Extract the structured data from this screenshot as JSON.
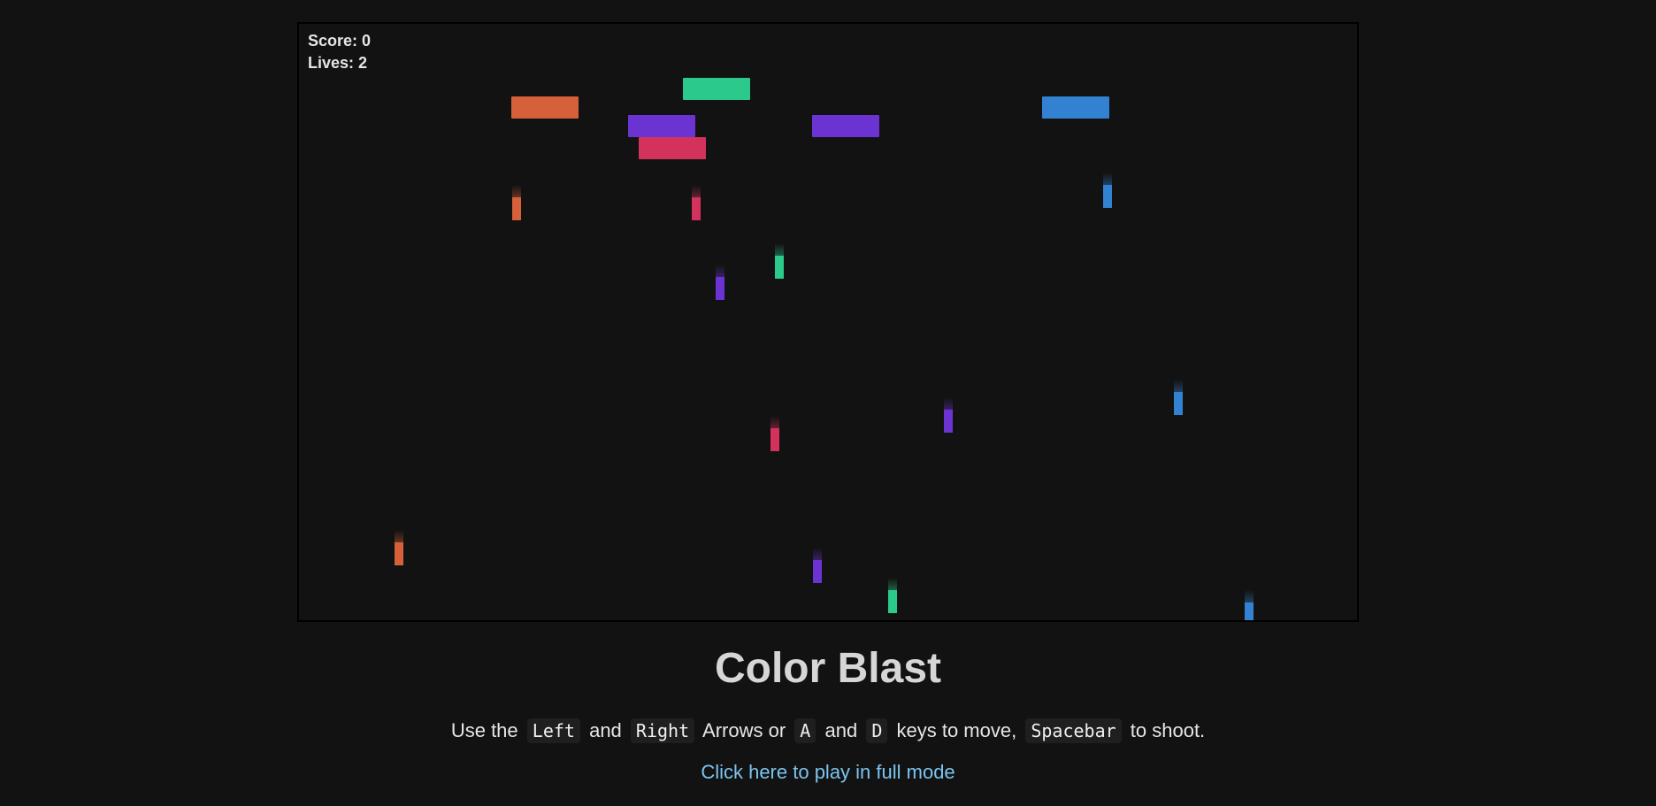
{
  "hud": {
    "score_label": "Score: 0",
    "lives_label": "Lives: 2"
  },
  "colors": {
    "orange": "#d5603a",
    "green": "#2bc98b",
    "purple": "#6c33d3",
    "pink": "#d3325d",
    "blue": "#3282d1"
  },
  "page": {
    "title": "Color Blast",
    "instructions": {
      "t1": "Use the",
      "k1": "Left",
      "t2": "and",
      "k2": "Right",
      "t3": "Arrows or",
      "k3": "A",
      "t4": "and",
      "k4": "D",
      "t5": "keys to move,",
      "k5": "Spacebar",
      "t6": "to shoot."
    },
    "link_text": "Click here to play in full mode"
  }
}
